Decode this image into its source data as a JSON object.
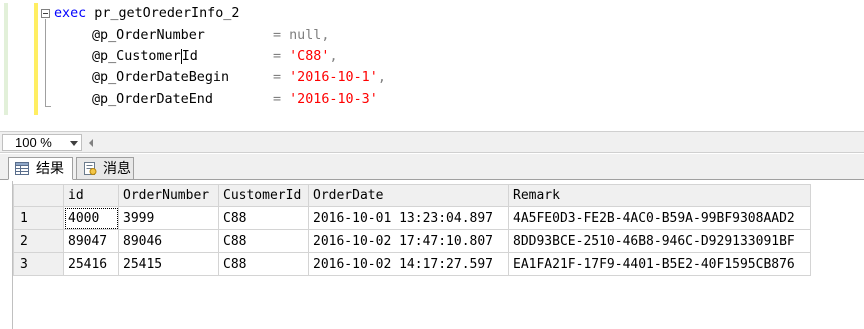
{
  "editor": {
    "lines": [
      {
        "kw": "exec",
        "rest": " pr_getOrederInfo_2"
      },
      {
        "param": "@p_OrderNumber",
        "eq": "= ",
        "value": "null",
        "value_type": "null",
        "suffix": ","
      },
      {
        "param": "@p_Customer",
        "param_after_caret": "Id",
        "eq": "= ",
        "value": "'C88'",
        "value_type": "string",
        "suffix": ","
      },
      {
        "param": "@p_OrderDateBegin",
        "eq": "= ",
        "value": "'2016-10-1'",
        "value_type": "string",
        "suffix": ","
      },
      {
        "param": "@p_OrderDateEnd",
        "eq": "= ",
        "value": "'2016-10-3'",
        "value_type": "string",
        "suffix": ""
      }
    ],
    "colors": {
      "keyword": "#0000ff",
      "string": "#ff0000",
      "operator": "#808080",
      "text": "#000000"
    }
  },
  "zoom": {
    "value": "100 %"
  },
  "tabs": [
    {
      "label": "结果",
      "icon": "grid-icon",
      "active": true
    },
    {
      "label": "消息",
      "icon": "messages-icon",
      "active": false
    }
  ],
  "results": {
    "columns": [
      "id",
      "OrderNumber",
      "CustomerId",
      "OrderDate",
      "Remark"
    ],
    "rows": [
      {
        "rownum": "1",
        "cells": [
          "4000",
          "3999",
          "C88",
          "2016-10-01 13:23:04.897",
          "4A5FE0D3-FE2B-4AC0-B59A-99BF9308AAD2"
        ]
      },
      {
        "rownum": "2",
        "cells": [
          "89047",
          "89046",
          "C88",
          "2016-10-02 17:47:10.807",
          "8DD93BCE-2510-46B8-946C-D929133091BF"
        ]
      },
      {
        "rownum": "3",
        "cells": [
          "25416",
          "25415",
          "C88",
          "2016-10-02 14:17:27.597",
          "EA1FA21F-17F9-4401-B5E2-40F1595CB876"
        ]
      }
    ]
  }
}
